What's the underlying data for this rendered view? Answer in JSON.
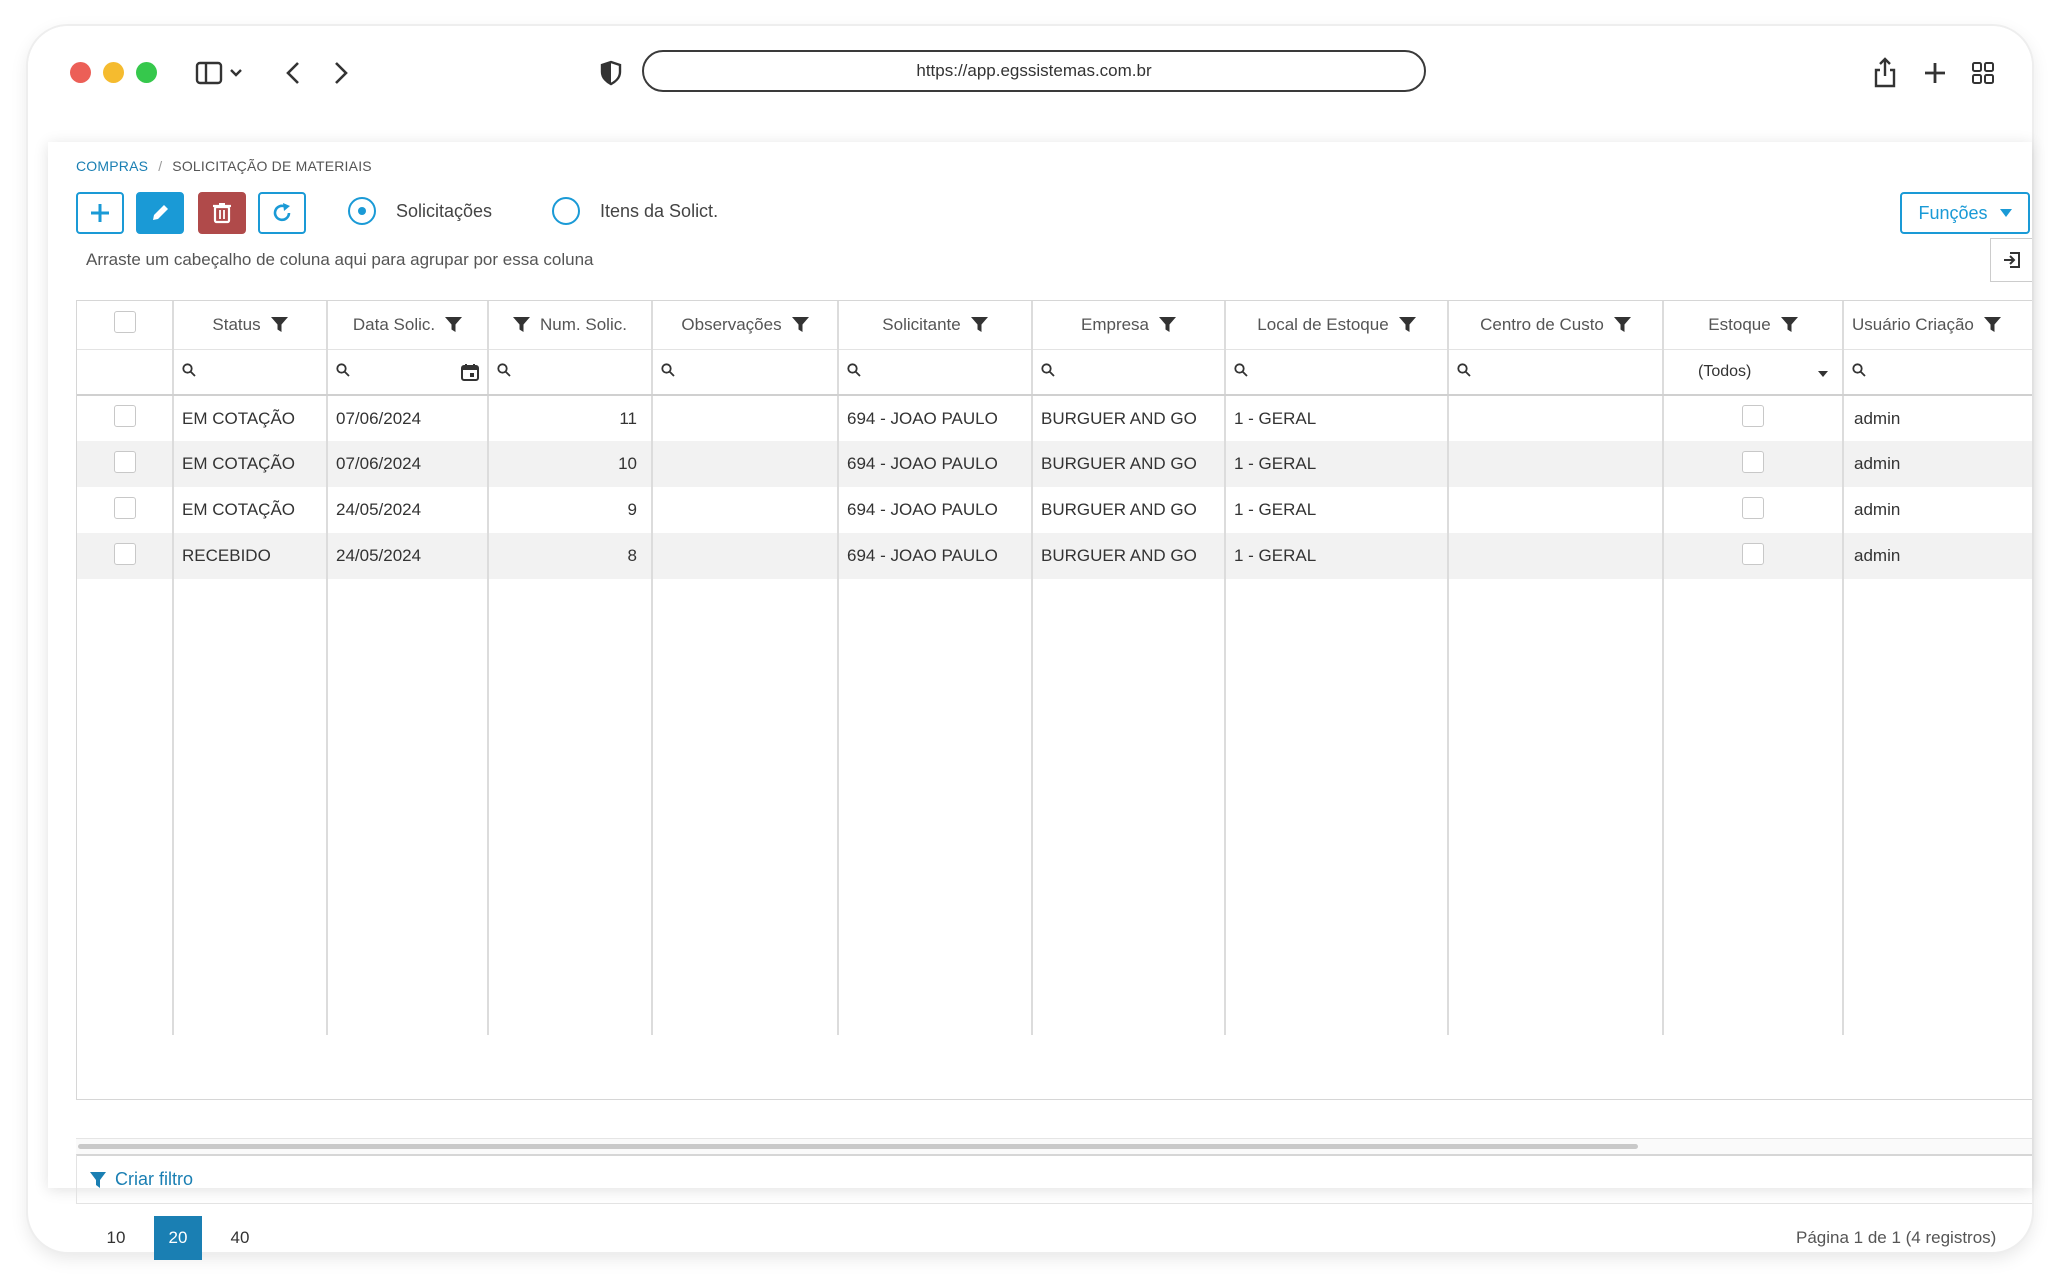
{
  "browser": {
    "url": "https://app.egssistemas.com.br",
    "traffic_lights": {
      "red": "#ec5f57",
      "yellow": "#f5bb2f",
      "green": "#36c84c"
    }
  },
  "breadcrumb": {
    "root": "COMPRAS",
    "separator": "/",
    "current": "SOLICITAÇÃO DE MATERIAIS"
  },
  "toolbar": {
    "add_icon": "plus-icon",
    "edit_icon": "pencil-icon",
    "delete_icon": "trash-icon",
    "refresh_icon": "refresh-icon",
    "radio_solicitacoes": "Solicitações",
    "radio_itens": "Itens da Solict.",
    "selected_radio": "Solicitações",
    "funcoes_label": "Funções"
  },
  "group_hint": "Arraste um cabeçalho de coluna aqui para agrupar por essa coluna",
  "grid": {
    "columns": [
      {
        "label": "Status"
      },
      {
        "label": "Data Solic."
      },
      {
        "label": "Num. Solic."
      },
      {
        "label": "Observações"
      },
      {
        "label": "Solicitante"
      },
      {
        "label": "Empresa"
      },
      {
        "label": "Local de Estoque"
      },
      {
        "label": "Centro de Custo"
      },
      {
        "label": "Estoque"
      },
      {
        "label": "Usuário Criação"
      }
    ],
    "estoque_filter": "(Todos)",
    "rows": [
      {
        "status": "EM COTAÇÃO",
        "data": "07/06/2024",
        "num": "11",
        "obs": "",
        "solicitante": "694 - JOAO PAULO",
        "empresa": "BURGUER AND GO",
        "local": "1 - GERAL",
        "centro": "",
        "usuario": "admin"
      },
      {
        "status": "EM COTAÇÃO",
        "data": "07/06/2024",
        "num": "10",
        "obs": "",
        "solicitante": "694 - JOAO PAULO",
        "empresa": "BURGUER AND GO",
        "local": "1 - GERAL",
        "centro": "",
        "usuario": "admin"
      },
      {
        "status": "EM COTAÇÃO",
        "data": "24/05/2024",
        "num": "9",
        "obs": "",
        "solicitante": "694 - JOAO PAULO",
        "empresa": "BURGUER AND GO",
        "local": "1 - GERAL",
        "centro": "",
        "usuario": "admin"
      },
      {
        "status": "RECEBIDO",
        "data": "24/05/2024",
        "num": "8",
        "obs": "",
        "solicitante": "694 - JOAO PAULO",
        "empresa": "BURGUER AND GO",
        "local": "1 - GERAL",
        "centro": "",
        "usuario": "admin"
      }
    ]
  },
  "filter_bar": {
    "label": "Criar filtro"
  },
  "pager": {
    "sizes": [
      "10",
      "20",
      "40"
    ],
    "active": "20",
    "info": "Página 1 de 1 (4 registros)"
  },
  "colors": {
    "accent": "#1a9ad6",
    "link": "#1a7fb3",
    "danger": "#b04a4a"
  }
}
